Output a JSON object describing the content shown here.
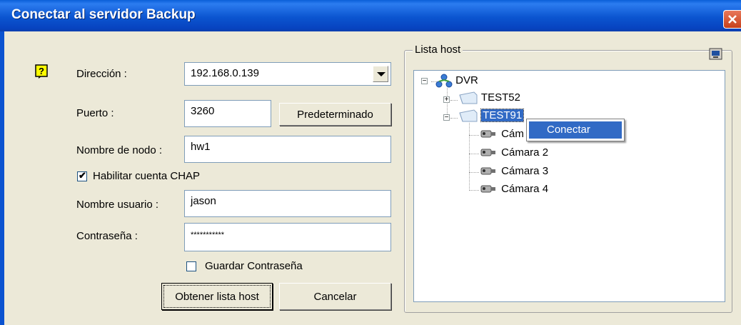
{
  "window": {
    "title": "Conectar al servidor Backup"
  },
  "form": {
    "direccion_label": "Dirección :",
    "direccion_value": "192.168.0.139",
    "puerto_label": "Puerto :",
    "puerto_value": "3260",
    "predeterminado_label": "Predeterminado",
    "nodo_label": "Nombre de nodo :",
    "nodo_value": "hw1",
    "chap_label": "Habilitar cuenta CHAP",
    "chap_checked": true,
    "usuario_label": "Nombre usuario :",
    "usuario_value": "jason",
    "contrasena_label": "Contraseña :",
    "contrasena_value": "***********",
    "guardar_label": "Guardar Contraseña",
    "guardar_checked": false
  },
  "buttons": {
    "obtener_label": "Obtener lista host",
    "cancelar_label": "Cancelar"
  },
  "host_list": {
    "group_label": "Lista host",
    "root": "DVR",
    "hosts": [
      "TEST52",
      "TEST91"
    ],
    "cameras_visible_partial": "Cám",
    "cameras": [
      "Cámara 2",
      "Cámara 3",
      "Cámara 4"
    ]
  },
  "context_menu": {
    "item": "Conectar"
  },
  "icons": [
    "help-icon",
    "close-icon",
    "network-icon",
    "dvr-folder-icon",
    "camera-icon",
    "host-list-icon"
  ]
}
